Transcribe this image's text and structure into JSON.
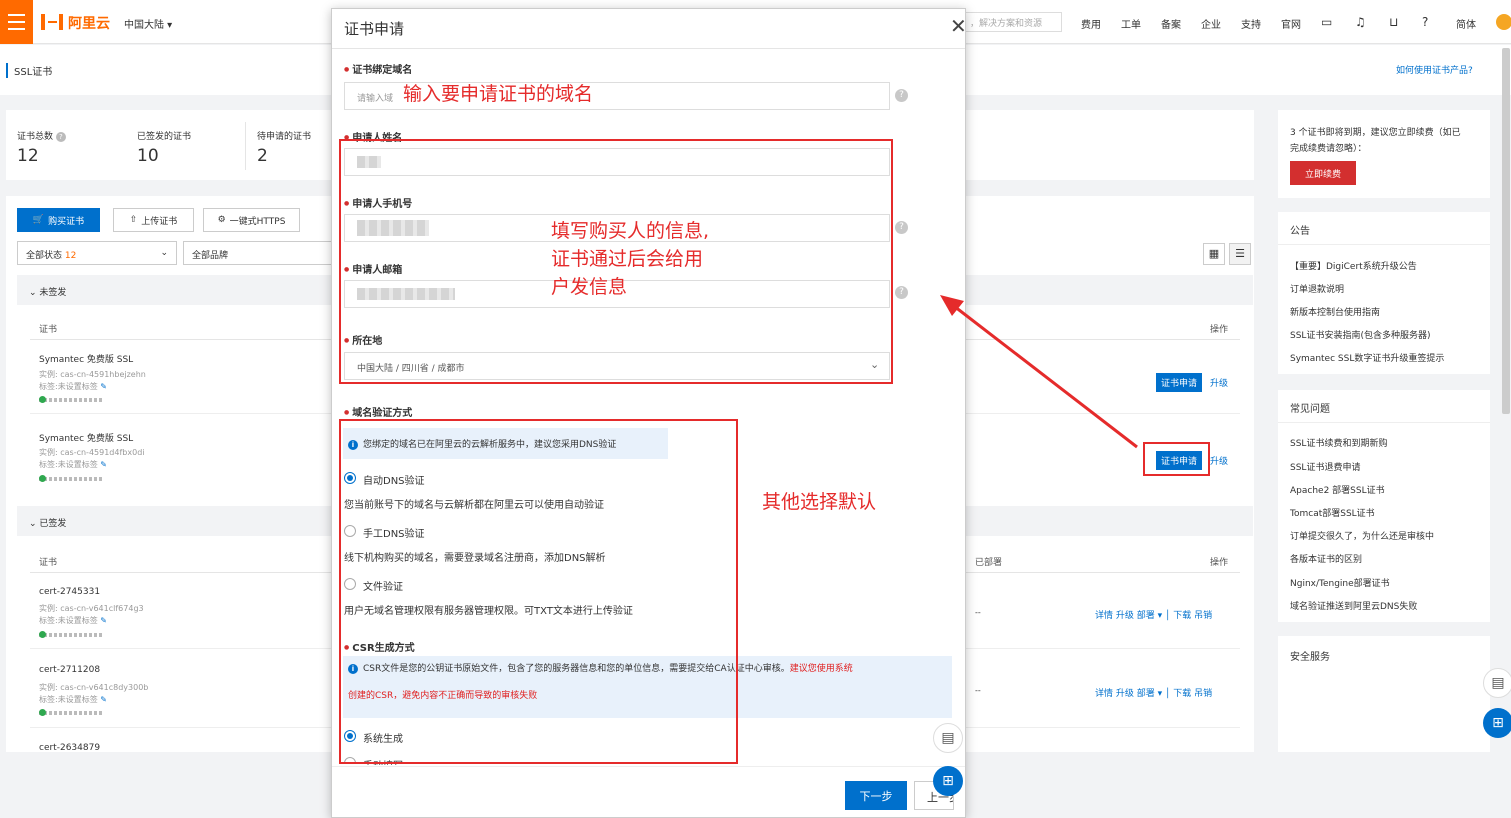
{
  "topbar": {
    "logo_text": "阿里云",
    "region": "中国大陆 ▾",
    "search_fragment": "，解决方案和资源",
    "nav": [
      "费用",
      "工单",
      "备案",
      "企业",
      "支持",
      "官网",
      "简体"
    ]
  },
  "page": {
    "title": "SSL证书",
    "help_link": "如何使用证书产品?"
  },
  "stats": [
    {
      "label": "证书总数",
      "value": "12"
    },
    {
      "label": "已签发的证书",
      "value": "10"
    },
    {
      "label": "待申请的证书",
      "value": "2"
    }
  ],
  "toolbar": {
    "buy": "购买证书",
    "upload": "上传证书",
    "https": "一键式HTTPS",
    "filter_status": "全部状态",
    "filter_status_count": "12",
    "filter_brand": "全部品牌"
  },
  "list": {
    "group_unsigned": "未签发",
    "group_signed": "已签发",
    "col_cert": "证书",
    "col_ops": "操作",
    "col_deploy": "已部署",
    "unsigned_rows": [
      {
        "name": "Symantec 免费版 SSL",
        "instance": "实例: cas-cn-4591hbejzehn",
        "tag": "标签:未设置标签"
      },
      {
        "name": "Symantec 免费版 SSL",
        "instance": "实例: cas-cn-4591d4fbx0di",
        "tag": "标签:未设置标签"
      }
    ],
    "signed_rows": [
      {
        "name": "cert-2745331",
        "instance": "实例: cas-cn-v641clf674g3",
        "tag": "标签:未设置标签"
      },
      {
        "name": "cert-2711208",
        "instance": "实例: cas-cn-v641c8dy300b",
        "tag": "标签:未设置标签"
      },
      {
        "name": "cert-2634879"
      }
    ],
    "apply": "证书申请",
    "upgrade": "升级",
    "signed_ops": "详情  升级  部署 ▾ │ 下载  吊销",
    "dash": "--"
  },
  "right": {
    "notice_text_1": "3 个证书即将到期，建议您立即续费（如已",
    "notice_text_2": "完成续费请忽略）：",
    "renew": "立即续费",
    "announce_title": "公告",
    "announce": [
      "【重要】DigiCert系统升级公告",
      "订单退款说明",
      "新版本控制台使用指南",
      "SSL证书安装指南(包含多种服务器)",
      "Symantec SSL数字证书升级重签提示"
    ],
    "faq_title": "常见问题",
    "faq": [
      "SSL证书续费和到期新购",
      "SSL证书退费申请",
      "Apache2 部署SSL证书",
      "Tomcat部署SSL证书",
      "订单提交很久了，为什么还是审核中",
      "各版本证书的区别",
      "Nginx/Tengine部署证书",
      "域名验证推送到阿里云DNS失败"
    ],
    "security_title": "安全服务"
  },
  "modal": {
    "title": "证书申请",
    "domain_label": "证书绑定域名",
    "domain_placeholder": "请输入域",
    "name_label": "申请人姓名",
    "phone_label": "申请人手机号",
    "email_label": "申请人邮箱",
    "location_label": "所在地",
    "location_value": "中国大陆 / 四川省 / 成都市",
    "verify_label": "域名验证方式",
    "verify_info": "您绑定的域名已在阿里云的云解析服务中，建议您采用DNS验证",
    "auto_dns": "自动DNS验证",
    "auto_dns_desc": "您当前账号下的域名与云解析都在阿里云可以使用自动验证",
    "manual_dns": "手工DNS验证",
    "manual_dns_desc": "线下机构购买的域名，需要登录域名注册商，添加DNS解析",
    "file_verify": "文件验证",
    "file_verify_desc": "用户无域名管理权限有服务器管理权限。可TXT文本进行上传验证",
    "csr_label": "CSR生成方式",
    "csr_info_1": "CSR文件是您的公钥证书原始文件，包含了您的服务器信息和您的单位信息，需要提交给CA认证中心审核。",
    "csr_info_red_1": "建议您使用系统",
    "csr_info_red_2": "创建的CSR，避免内容不正确而导致的审核失败",
    "sys_gen": "系统生成",
    "manual_fill": "手动填写",
    "next": "下一步",
    "prev": "上一步"
  },
  "annotations": {
    "domain": "输入要申请证书的域名",
    "buyer_1": "填写购买人的信息,",
    "buyer_2": "证书通过后会给用",
    "buyer_3": "户发信息",
    "default": "其他选择默认"
  },
  "colors": {
    "brand": "#ff6a00",
    "primary": "#0070cc",
    "annotation": "#e52b2b"
  }
}
